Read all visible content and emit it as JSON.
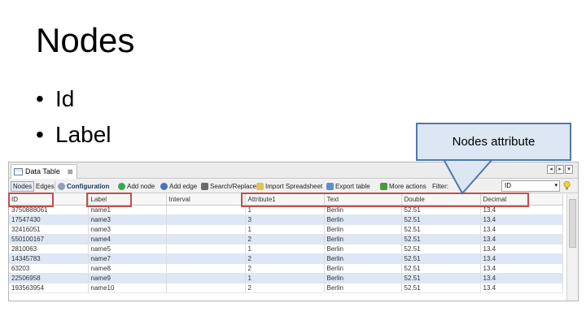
{
  "slide": {
    "title": "Nodes",
    "bullets": [
      "Id",
      "Label"
    ],
    "callout": "Nodes attribute"
  },
  "app": {
    "tab_label": "Data Table",
    "tab_close": "⊠",
    "window_buttons": [
      "◂",
      "▸",
      "▾"
    ],
    "toolbar": {
      "nodes": "Nodes",
      "edges": "Edges",
      "configuration": "Configuration",
      "add_node": "Add node",
      "add_edge": "Add edge",
      "search_replace": "Search/Replace",
      "import_spreadsheet": "Import Spreadsheet",
      "export_table": "Export table",
      "more_actions": "More actions",
      "filter": "Filter:",
      "filter_value": "ID",
      "filter_caret": "▾"
    },
    "table": {
      "columns": [
        "ID",
        "Label",
        "Interval",
        "Attribute1",
        "Text",
        "Double",
        "Decimal"
      ],
      "rows": [
        [
          "3750888061",
          "name1",
          "",
          "1",
          "Berlin",
          "52.51",
          "13.4"
        ],
        [
          "17547430",
          "name3",
          "",
          "3",
          "Berlin",
          "52.51",
          "13.4"
        ],
        [
          "32416051",
          "name3",
          "",
          "1",
          "Berlin",
          "52.51",
          "13.4"
        ],
        [
          "550100167",
          "name4",
          "",
          "2",
          "Berlin",
          "52.51",
          "13.4"
        ],
        [
          "2810063",
          "name5",
          "",
          "1",
          "Berlin",
          "52.51",
          "13.4"
        ],
        [
          "14345783",
          "name7",
          "",
          "2",
          "Berlin",
          "52.51",
          "13.4"
        ],
        [
          "63203",
          "name8",
          "",
          "2",
          "Berlin",
          "52.51",
          "13.4"
        ],
        [
          "22506958",
          "name9",
          "",
          "1",
          "Berlin",
          "52.51",
          "13.4"
        ],
        [
          "193563954",
          "name10",
          "",
          "2",
          "Berlin",
          "52.51",
          "13.4"
        ]
      ]
    }
  },
  "colors": {
    "highlight": "#c0504d",
    "callout_fill": "#dde7f3",
    "callout_border": "#4d79b0",
    "row_alt": "#dde7f5"
  }
}
